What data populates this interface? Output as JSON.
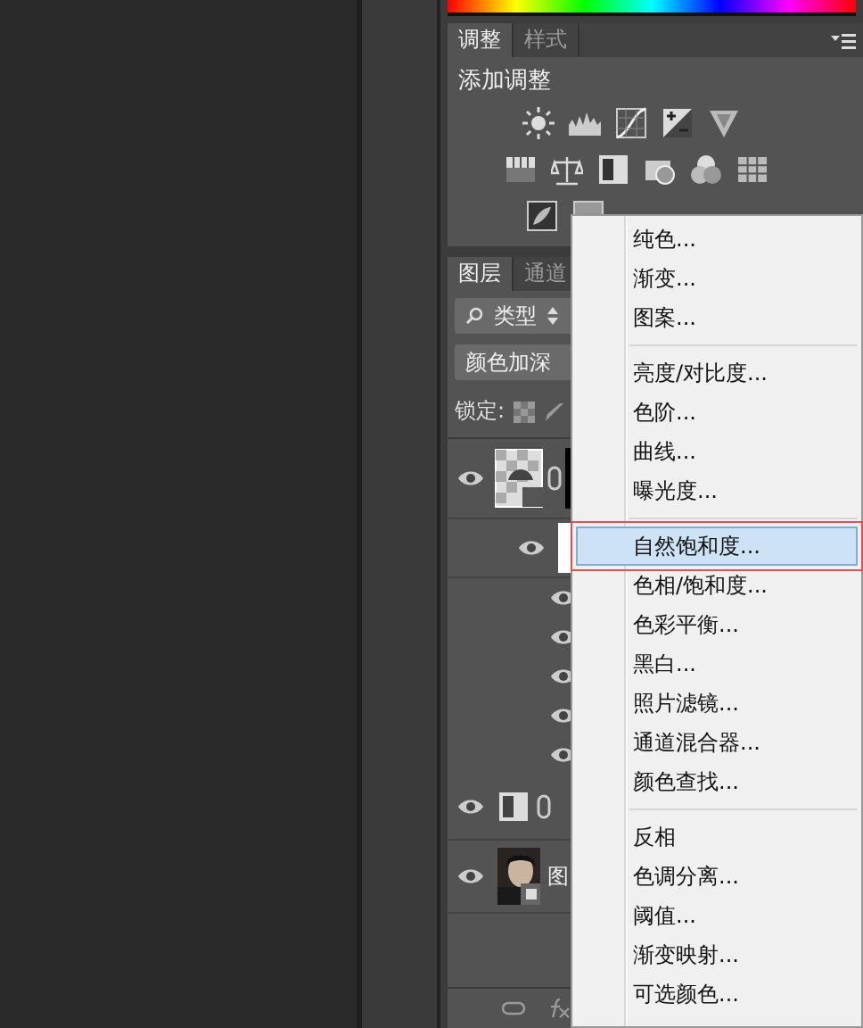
{
  "adjustments_panel": {
    "tabs": [
      {
        "label": "调整",
        "selected": true
      },
      {
        "label": "样式",
        "selected": false
      }
    ],
    "heading": "添加调整"
  },
  "layers_panel": {
    "tabs": [
      {
        "label": "图层",
        "selected": true
      },
      {
        "label": "通道",
        "selected": false
      }
    ],
    "filter": "类型",
    "blend_mode": "颜色加深",
    "lock_label": "锁定:",
    "layers": [
      {
        "kind": "smart",
        "visible": true
      },
      {
        "kind": "mask",
        "visible": true
      },
      {
        "kind": "filter",
        "visible": true
      },
      {
        "kind": "filter",
        "visible": true
      },
      {
        "kind": "filter",
        "visible": true
      },
      {
        "kind": "filter",
        "visible": true
      },
      {
        "kind": "filter",
        "visible": true
      },
      {
        "kind": "adjustment",
        "visible": true
      },
      {
        "visible": true,
        "name": "图"
      }
    ]
  },
  "context_menu": {
    "groups": [
      [
        {
          "label": "纯色...",
          "selected": false
        },
        {
          "label": "渐变...",
          "selected": false
        },
        {
          "label": "图案...",
          "selected": false
        }
      ],
      [
        {
          "label": "亮度/对比度...",
          "selected": false
        },
        {
          "label": "色阶...",
          "selected": false
        },
        {
          "label": "曲线...",
          "selected": false
        },
        {
          "label": "曝光度...",
          "selected": false
        }
      ],
      [
        {
          "label": "自然饱和度...",
          "selected": true
        },
        {
          "label": "色相/饱和度...",
          "selected": false
        },
        {
          "label": "色彩平衡...",
          "selected": false
        },
        {
          "label": "黑白...",
          "selected": false
        },
        {
          "label": "照片滤镜...",
          "selected": false
        },
        {
          "label": "通道混合器...",
          "selected": false
        },
        {
          "label": "颜色查找...",
          "selected": false
        }
      ],
      [
        {
          "label": "反相",
          "selected": false
        },
        {
          "label": "色调分离...",
          "selected": false
        },
        {
          "label": "阈值...",
          "selected": false
        },
        {
          "label": "渐变映射...",
          "selected": false
        },
        {
          "label": "可选颜色...",
          "selected": false
        }
      ]
    ]
  }
}
